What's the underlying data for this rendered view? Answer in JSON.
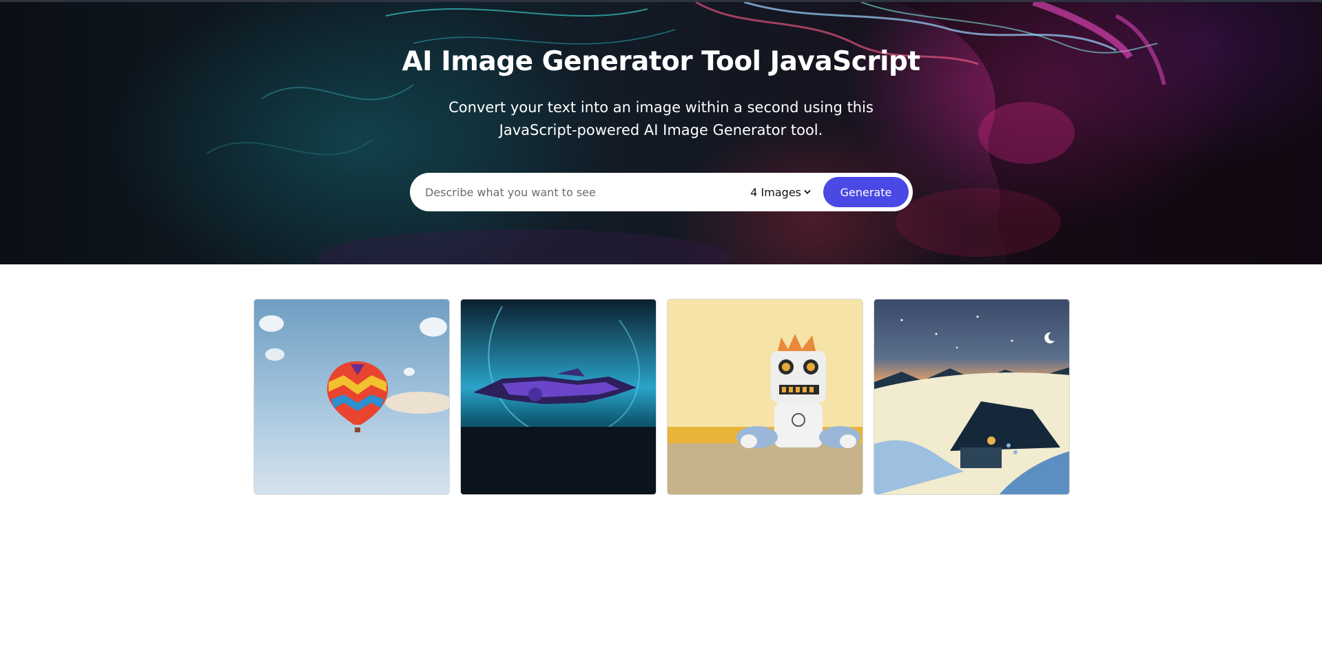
{
  "hero": {
    "title": "AI Image Generator Tool JavaScript",
    "subtitle_line1": "Convert your text into an image within a second using this",
    "subtitle_line2": "JavaScript-powered AI Image Generator tool."
  },
  "search": {
    "placeholder": "Describe what you want to see",
    "value": ""
  },
  "image_count": {
    "selected": "4 Images"
  },
  "generate_button": {
    "label": "Generate"
  },
  "colors": {
    "accent": "#4a49e6",
    "hero_text": "#ffffff",
    "page_bg": "#ffffff"
  },
  "gallery": {
    "items": [
      {
        "icon": "hot-air-balloon-image"
      },
      {
        "icon": "spaceship-image"
      },
      {
        "icon": "robot-plush-image"
      },
      {
        "icon": "snowy-cabin-image"
      }
    ]
  }
}
